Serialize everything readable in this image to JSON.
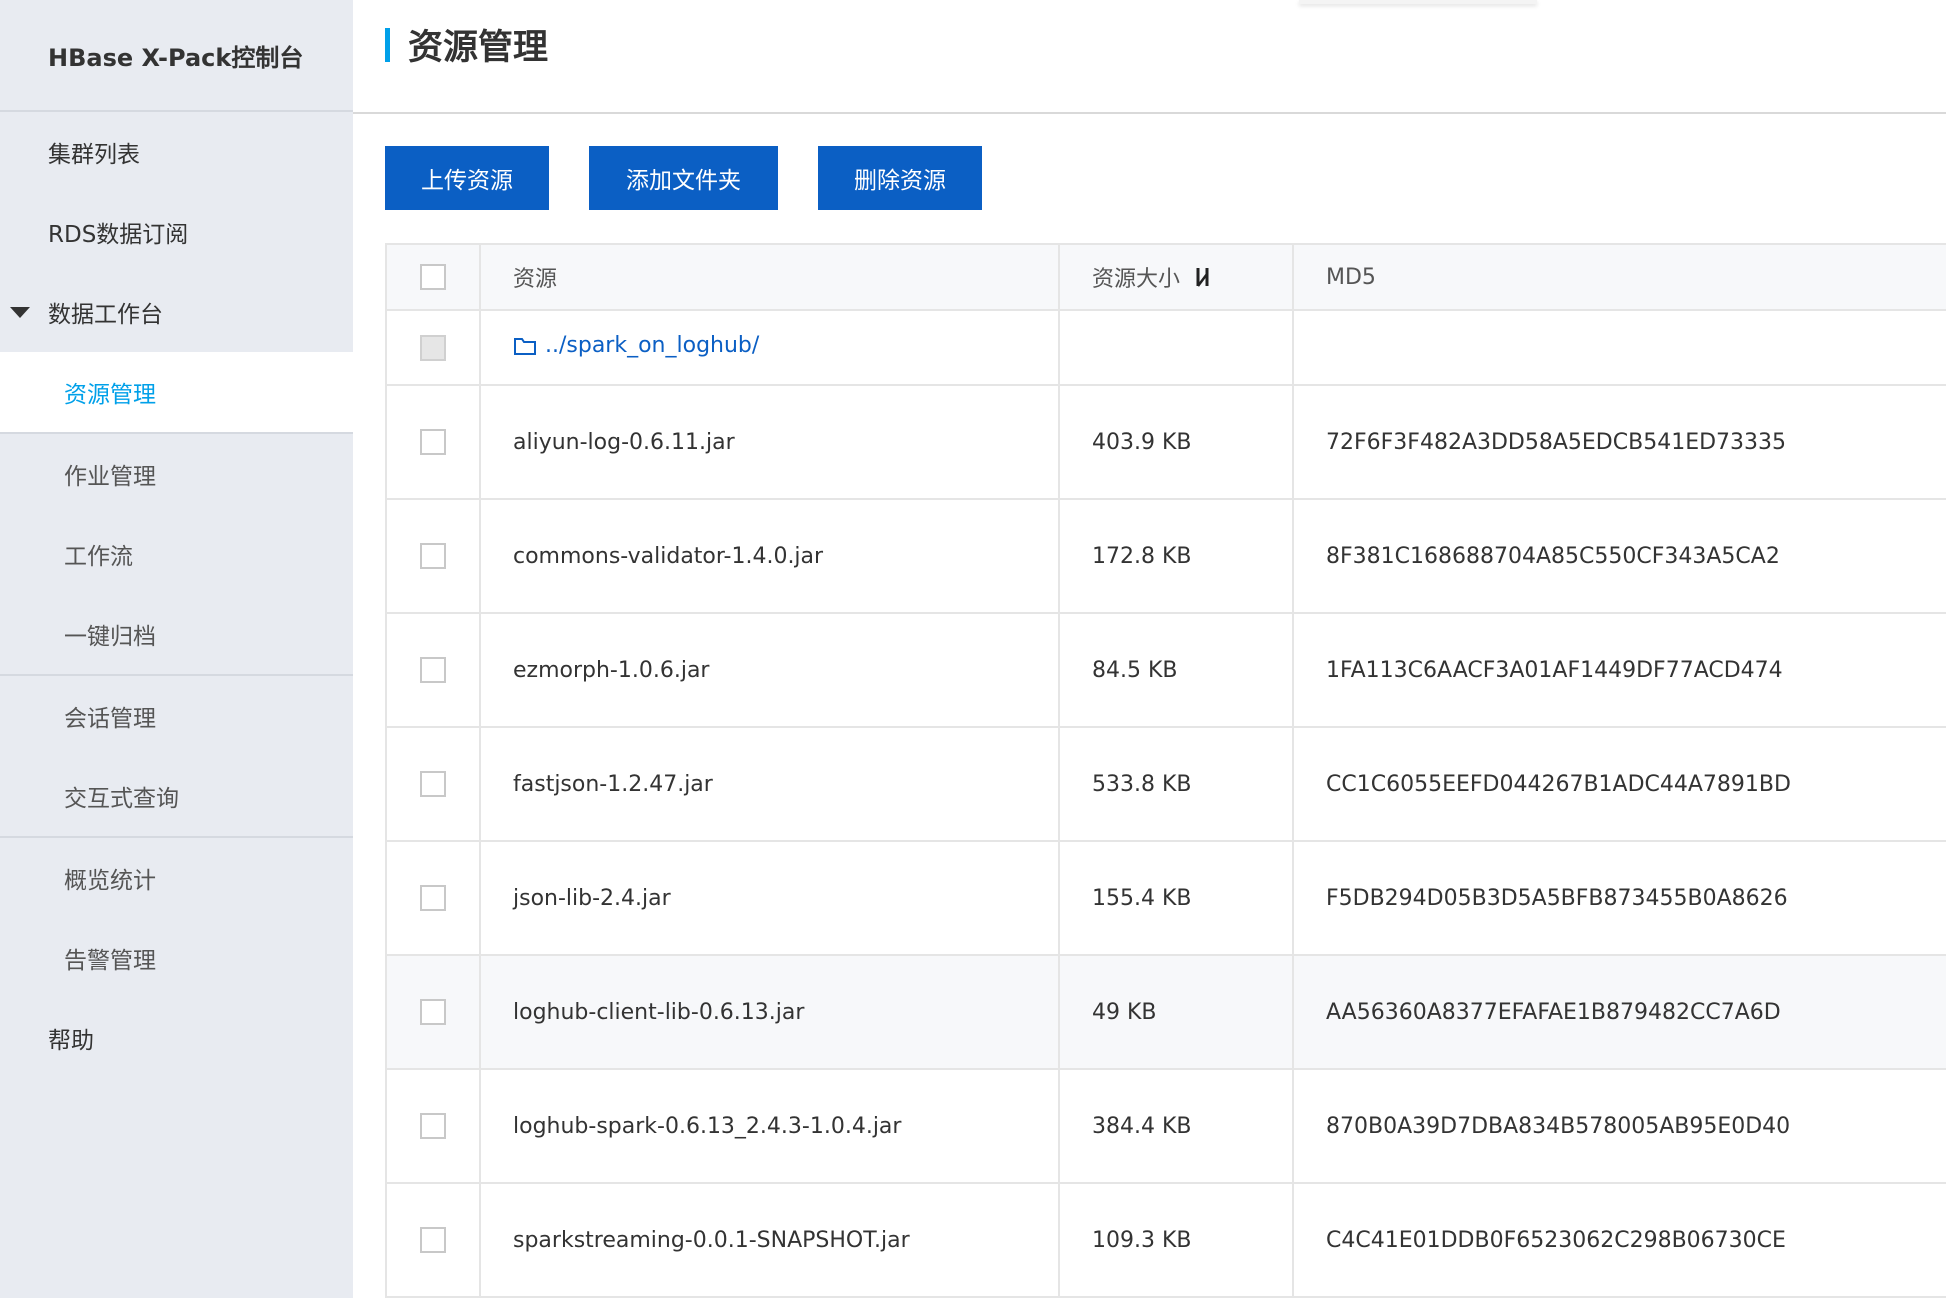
{
  "app": {
    "brand": "HBase X-Pack控制台"
  },
  "sidebar": {
    "items": [
      {
        "label": "集群列表"
      },
      {
        "label": "RDS数据订阅"
      },
      {
        "label": "数据工作台"
      },
      {
        "label": "资源管理"
      },
      {
        "label": "作业管理"
      },
      {
        "label": "工作流"
      },
      {
        "label": "一键归档"
      },
      {
        "label": "会话管理"
      },
      {
        "label": "交互式查询"
      },
      {
        "label": "概览统计"
      },
      {
        "label": "告警管理"
      },
      {
        "label": "帮助"
      }
    ]
  },
  "page": {
    "title": "资源管理"
  },
  "toolbar": {
    "upload_label": "上传资源",
    "add_folder_label": "添加文件夹",
    "delete_label": "删除资源"
  },
  "table": {
    "columns": {
      "name": "资源",
      "size": "资源大小",
      "md5": "MD5"
    },
    "folder": {
      "name": "../spark_on_loghub/"
    },
    "rows": [
      {
        "name": "aliyun-log-0.6.11.jar",
        "size": "403.9 KB",
        "md5": "72F6F3F482A3DD58A5EDCB541ED73335"
      },
      {
        "name": "commons-validator-1.4.0.jar",
        "size": "172.8 KB",
        "md5": "8F381C168688704A85C550CF343A5CA2"
      },
      {
        "name": "ezmorph-1.0.6.jar",
        "size": "84.5 KB",
        "md5": "1FA113C6AACF3A01AF1449DF77ACD474"
      },
      {
        "name": "fastjson-1.2.47.jar",
        "size": "533.8 KB",
        "md5": "CC1C6055EEFD044267B1ADC44A7891BD"
      },
      {
        "name": "json-lib-2.4.jar",
        "size": "155.4 KB",
        "md5": "F5DB294D05B3D5A5BFB873455B0A8626"
      },
      {
        "name": "loghub-client-lib-0.6.13.jar",
        "size": "49 KB",
        "md5": "AA56360A8377EFAFAE1B879482CC7A6D"
      },
      {
        "name": "loghub-spark-0.6.13_2.4.3-1.0.4.jar",
        "size": "384.4 KB",
        "md5": "870B0A39D7DBA834B578005AB95E0D40"
      },
      {
        "name": "sparkstreaming-0.0.1-SNAPSHOT.jar",
        "size": "109.3 KB",
        "md5": "C4C41E01DDB0F6523062C298B06730CE"
      }
    ]
  },
  "colors": {
    "primary": "#0b5fc4",
    "accent": "#00a0e9",
    "sidebar_bg": "#e8ebf1"
  }
}
